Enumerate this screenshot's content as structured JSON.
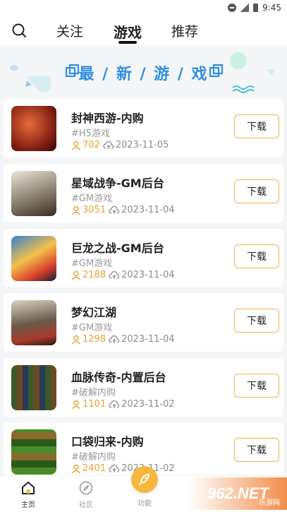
{
  "status_bar": {
    "time": "9:45"
  },
  "top_nav": {
    "tabs": [
      {
        "label": "关注"
      },
      {
        "label": "游戏"
      },
      {
        "label": "推荐"
      }
    ]
  },
  "banner": {
    "title": "最 / 新 / 游 / 戏"
  },
  "games": [
    {
      "title": "封神西游-内购",
      "tag": "#H5游戏",
      "users": "702",
      "date": "2023-11-05",
      "button": "下载"
    },
    {
      "title": "星域战争-GM后台",
      "tag": "#GM游戏",
      "users": "3051",
      "date": "2023-11-04",
      "button": "下载"
    },
    {
      "title": "巨龙之战-GM后台",
      "tag": "#GM游戏",
      "users": "2188",
      "date": "2023-11-04",
      "button": "下载"
    },
    {
      "title": "梦幻江湖",
      "tag": "#GM游戏",
      "users": "1298",
      "date": "2023-11-04",
      "button": "下载"
    },
    {
      "title": "血脉传奇-内置后台",
      "tag": "#破解内购",
      "users": "1101",
      "date": "2023-11-02",
      "button": "下载"
    },
    {
      "title": "口袋归来-内购",
      "tag": "#破解内购",
      "users": "2401",
      "date": "2023-11-02",
      "button": "下载"
    }
  ],
  "bottom_nav": {
    "items": [
      {
        "label": "主页"
      },
      {
        "label": "社区"
      },
      {
        "label": "功能"
      }
    ]
  },
  "watermark": {
    "text": "962.NET",
    "sub": "乐游网"
  },
  "colors": {
    "accent": "#f5b83d",
    "banner_blue": "#2f8fe0",
    "count_orange": "#e8a233"
  }
}
